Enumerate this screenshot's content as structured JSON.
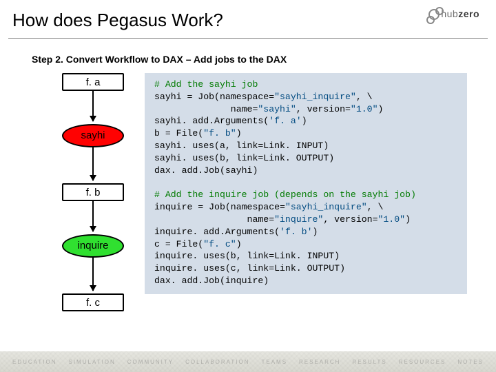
{
  "header": {
    "title": "How does Pegasus Work?",
    "logo_text_a": "hub",
    "logo_text_b": "zero"
  },
  "step_label": "Step 2. Convert Workflow to DAX – Add jobs to the DAX",
  "diagram": {
    "nodes": {
      "fa": "f. a",
      "say": "sayhi",
      "fb": "f. b",
      "inq": "inquire",
      "fc": "f. c"
    }
  },
  "code": {
    "c1": "# Add the sayhi job",
    "l2a": "sayhi = Job(namespace=",
    "l2s": "\"sayhi_inquire\"",
    "l2b": ", \\",
    "l3a": "              name=",
    "l3s1": "\"sayhi\"",
    "l3b": ", version=",
    "l3s2": "\"1.0\"",
    "l3c": ")",
    "l4a": "sayhi. add.Arguments(",
    "l4s": "'f. a'",
    "l4b": ")",
    "l5a": "b = File(",
    "l5s": "\"f. b\"",
    "l5b": ")",
    "l6": "sayhi. uses(a, link=Link. INPUT)",
    "l7": "sayhi. uses(b, link=Link. OUTPUT)",
    "l8": "dax. add.Job(sayhi)",
    "c9": "# Add the inquire job (depends on the sayhi job)",
    "l10a": "inquire = Job(namespace=",
    "l10s": "\"sayhi_inquire\"",
    "l10b": ", \\",
    "l11a": "                 name=",
    "l11s1": "\"inquire\"",
    "l11b": ", version=",
    "l11s2": "\"1.0\"",
    "l11c": ")",
    "l12a": "inquire. add.Arguments(",
    "l12s": "'f. b'",
    "l12b": ")",
    "l13a": "c = File(",
    "l13s": "\"f. c\"",
    "l13b": ")",
    "l14": "inquire. uses(b, link=Link. INPUT)",
    "l15": "inquire. uses(c, link=Link. OUTPUT)",
    "l16": "dax. add.Job(inquire)"
  },
  "footer": {
    "w1": "Education",
    "w2": "Simulation",
    "w3": "Community",
    "w4": "Collaboration",
    "w5": "Teams",
    "w6": "Research",
    "w7": "Results",
    "w8": "Resources",
    "w9": "Notes"
  }
}
